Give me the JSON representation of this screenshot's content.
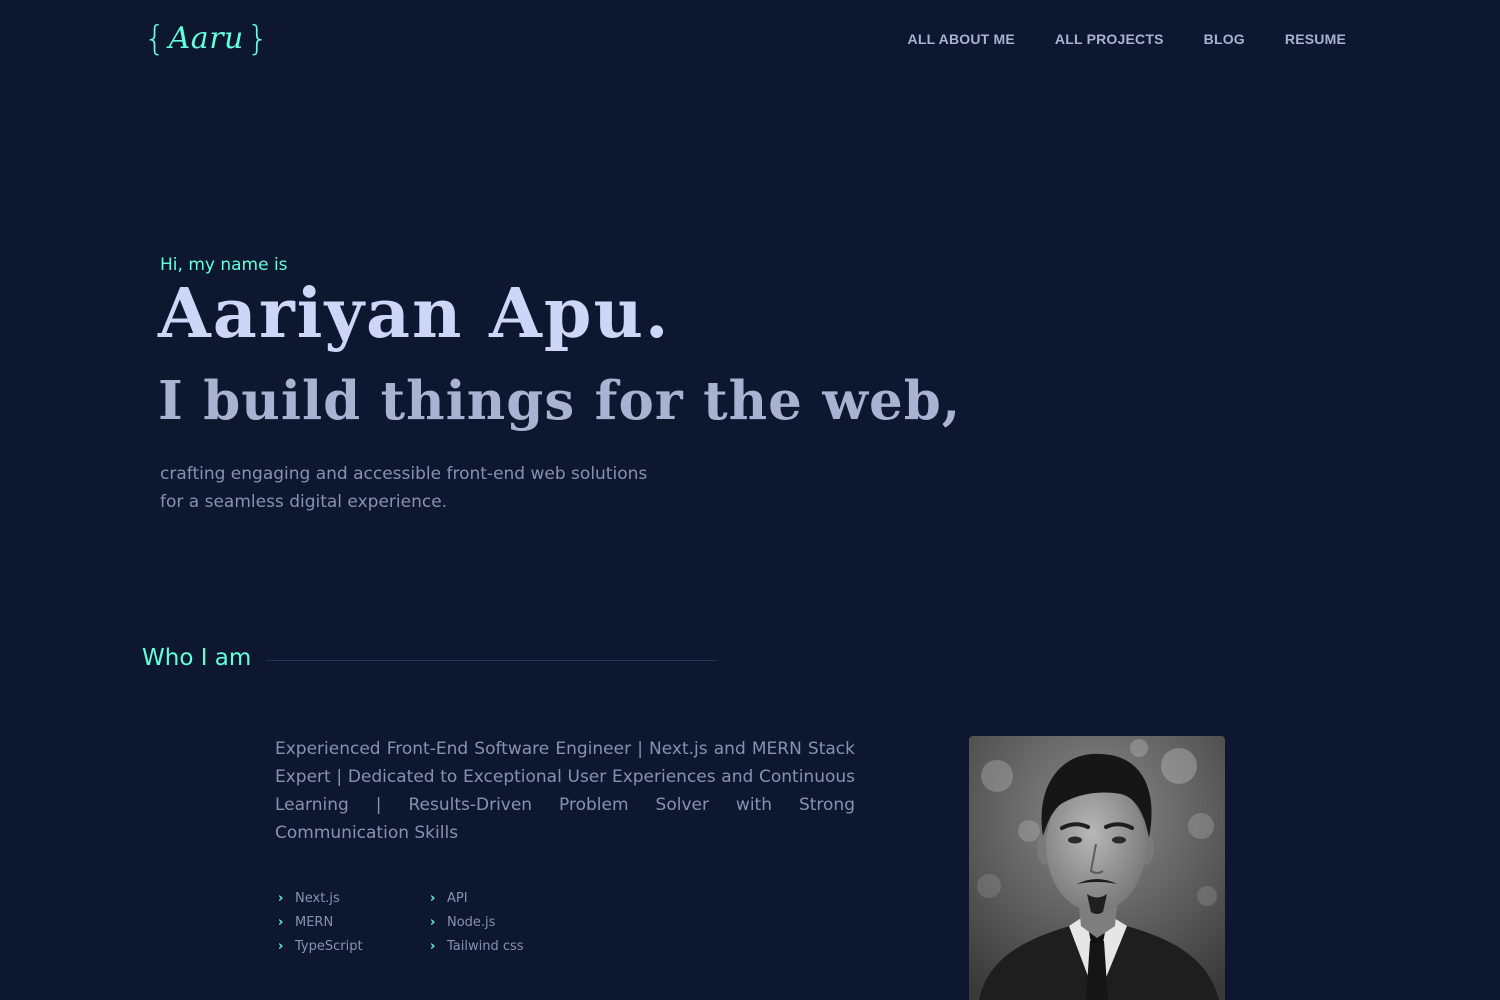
{
  "logo": {
    "open_brace": "{",
    "text": "Aaru",
    "close_brace": "}"
  },
  "nav": {
    "items": [
      {
        "label": "ALL ABOUT ME"
      },
      {
        "label": "ALL PROJECTS"
      },
      {
        "label": "BLOG"
      },
      {
        "label": "RESUME"
      }
    ]
  },
  "hero": {
    "greeting": "Hi, my name is",
    "name": "Aariyan Apu.",
    "tagline": "I build things for the web,",
    "description_lines": [
      "crafting engaging and accessible front-end web solutions",
      "for a seamless digital experience."
    ]
  },
  "about": {
    "heading": "Who I am",
    "bio": "Experienced Front-End Software Engineer | Next.js and MERN Stack Expert | Dedicated to Exceptional User Experiences and Continuous Learning | Results-Driven Problem Solver with Strong Communication Skills",
    "skills": [
      "Next.js",
      "API",
      "MERN",
      "Node.js",
      "TypeScript",
      "Tailwind css"
    ],
    "skill_icon": "chevron-right-icon",
    "portrait_icon": "portrait-photo"
  },
  "colors": {
    "background": "#0d1730",
    "accent": "#64ffda",
    "heading": "#ccd6f6",
    "subheading": "#a8b2d1",
    "body_text": "#8892b0",
    "divider": "#233554"
  }
}
